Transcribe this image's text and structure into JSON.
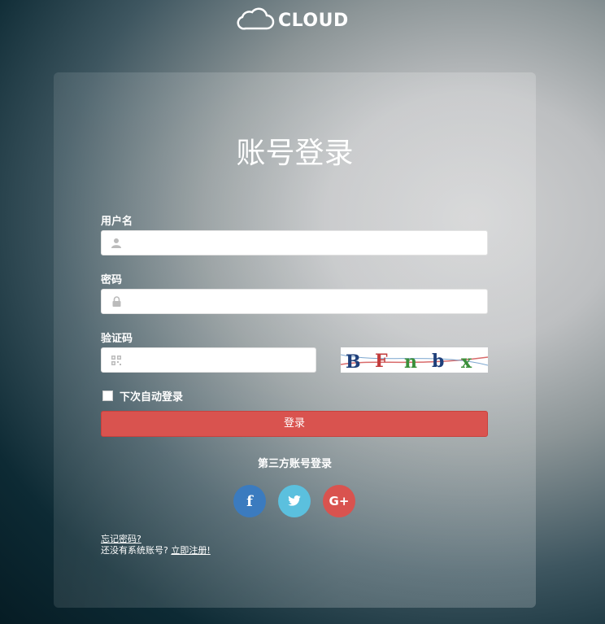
{
  "logo": {
    "text": "CLOUD",
    "icon": "cloud-icon"
  },
  "form": {
    "title": "账号登录",
    "username_label": "用户名",
    "password_label": "密码",
    "captcha_label": "验证码",
    "captcha_text": "BFnbx",
    "remember_label": "下次自动登录",
    "login_button": "登录"
  },
  "third_party": {
    "title": "第三方账号登录",
    "providers": [
      {
        "name": "facebook",
        "glyph": "f",
        "color": "#3b7bbf"
      },
      {
        "name": "twitter",
        "glyph": "twitter-bird",
        "color": "#5bc0de"
      },
      {
        "name": "google-plus",
        "glyph": "G+",
        "color": "#d9534f"
      }
    ]
  },
  "links": {
    "forgot": "忘记密码?",
    "no_account": "还没有系统账号?",
    "register": "立即注册!"
  }
}
